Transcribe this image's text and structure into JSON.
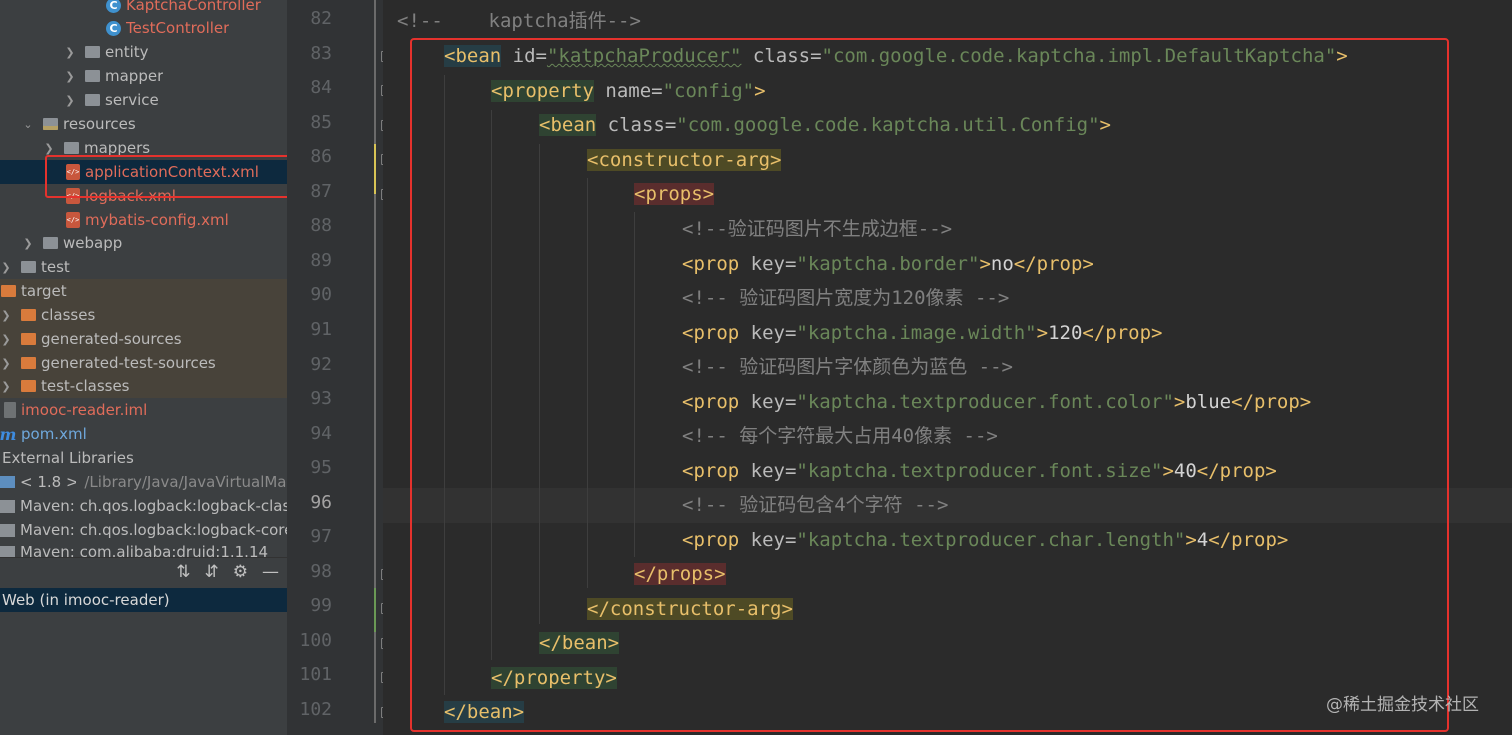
{
  "project_tree": {
    "items": [
      {
        "label": "KaptchaController",
        "icon": "class-icon",
        "style": "red"
      },
      {
        "label": "TestController",
        "icon": "class-icon",
        "style": "red"
      },
      {
        "label": "entity",
        "icon": "folder-icon"
      },
      {
        "label": "mapper",
        "icon": "folder-icon"
      },
      {
        "label": "service",
        "icon": "folder-icon"
      },
      {
        "label": "resources",
        "icon": "resources-folder-icon"
      },
      {
        "label": "mappers",
        "icon": "folder-icon"
      },
      {
        "label": "applicationContext.xml",
        "icon": "xml-file-icon",
        "style": "red",
        "selected": true
      },
      {
        "label": "logback.xml",
        "icon": "xml-file-icon",
        "style": "red"
      },
      {
        "label": "mybatis-config.xml",
        "icon": "xml-file-icon",
        "style": "red"
      },
      {
        "label": "webapp",
        "icon": "web-folder-icon"
      },
      {
        "label": "test",
        "icon": "folder-icon"
      },
      {
        "label": "target",
        "icon": "folder-icon",
        "excluded": true
      },
      {
        "label": "classes",
        "icon": "folder-icon",
        "excluded": true
      },
      {
        "label": "generated-sources",
        "icon": "folder-icon",
        "excluded": true
      },
      {
        "label": "generated-test-sources",
        "icon": "folder-icon",
        "excluded": true
      },
      {
        "label": "test-classes",
        "icon": "folder-icon",
        "excluded": true
      },
      {
        "label": "imooc-reader.iml",
        "icon": "iml-file-icon",
        "style": "red"
      },
      {
        "label": "pom.xml",
        "icon": "maven-icon",
        "style": "blue"
      },
      {
        "label": "External Libraries"
      },
      {
        "label": "< 1.8 >",
        "secondary": "/Library/Java/JavaVirtualMac",
        "icon": "jdk-icon"
      },
      {
        "label": "Maven: ch.qos.logback:logback-clas",
        "icon": "library-icon"
      },
      {
        "label": "Maven: ch.qos.logback:logback-core",
        "icon": "library-icon"
      },
      {
        "label": "Maven: com.alibaba:druid:1.1.14",
        "icon": "library-icon"
      }
    ]
  },
  "toolbar_icons": [
    "expand-all-icon",
    "collapse-all-icon",
    "gear-icon",
    "minimize-icon"
  ],
  "service_panel": {
    "selected_label": "Web (in imooc-reader)"
  },
  "editor": {
    "line_numbers": [
      "82",
      "83",
      "84",
      "85",
      "86",
      "87",
      "88",
      "89",
      "90",
      "91",
      "92",
      "93",
      "94",
      "95",
      "96",
      "97",
      "98",
      "99",
      "100",
      "101",
      "102"
    ],
    "current_line": "96",
    "lines": {
      "l82": {
        "open": "<!--",
        "text": "    kaptcha插件",
        "close": "-->"
      },
      "l83": {
        "tag_open": "<bean",
        "attr1": " id=",
        "val1": "\"katpchaProducer\"",
        "attr2": " class=",
        "val2": "\"com.google.code.kaptcha.impl.DefaultKaptcha\"",
        "end": ">"
      },
      "l84": {
        "tag_open": "<property",
        "attr1": " name=",
        "val1": "\"config\"",
        "end": ">"
      },
      "l85": {
        "tag_open": "<bean",
        "attr1": " class=",
        "val1": "\"com.google.code.kaptcha.util.Config\"",
        "end": ">"
      },
      "l86": {
        "tag": "<constructor-arg>"
      },
      "l87": {
        "tag": "<props>"
      },
      "l88": {
        "comment": "<!--验证码图片不生成边框-->"
      },
      "l89": {
        "tag_open": "<prop",
        "attr1": " key=",
        "val1": "\"kaptcha.border\"",
        "end": ">",
        "text": "no",
        "close": "</prop>"
      },
      "l90": {
        "comment": "<!-- 验证码图片宽度为120像素 -->"
      },
      "l91": {
        "tag_open": "<prop",
        "attr1": " key=",
        "val1": "\"kaptcha.image.width\"",
        "end": ">",
        "text": "120",
        "close": "</prop>"
      },
      "l92": {
        "comment": "<!-- 验证码图片字体颜色为蓝色 -->"
      },
      "l93": {
        "tag_open": "<prop",
        "attr1": " key=",
        "val1": "\"kaptcha.textproducer.font.color\"",
        "end": ">",
        "text": "blue",
        "close": "</prop>"
      },
      "l94": {
        "comment": "<!-- 每个字符最大占用40像素 -->"
      },
      "l95": {
        "tag_open": "<prop",
        "attr1": " key=",
        "val1": "\"kaptcha.textproducer.font.size\"",
        "end": ">",
        "text": "40",
        "close": "</prop>"
      },
      "l96": {
        "comment": "<!-- 验证码包含4个字符 -->"
      },
      "l97": {
        "tag_open": "<prop",
        "attr1": " key=",
        "val1": "\"kaptcha.textproducer.char.length\"",
        "end": ">",
        "text": "4",
        "close": "</prop>"
      },
      "l98": {
        "tag": "</props>"
      },
      "l99": {
        "tag": "</constructor-arg>"
      },
      "l100": {
        "tag": "</bean>"
      },
      "l101": {
        "tag": "</property>"
      },
      "l102": {
        "tag": "</bean>"
      }
    }
  },
  "watermark": "@稀土掘金技术社区",
  "colors": {
    "highlight_box": "#e5322d",
    "tag": "#e8bf6a",
    "string": "#6a8759",
    "comment": "#808080"
  }
}
